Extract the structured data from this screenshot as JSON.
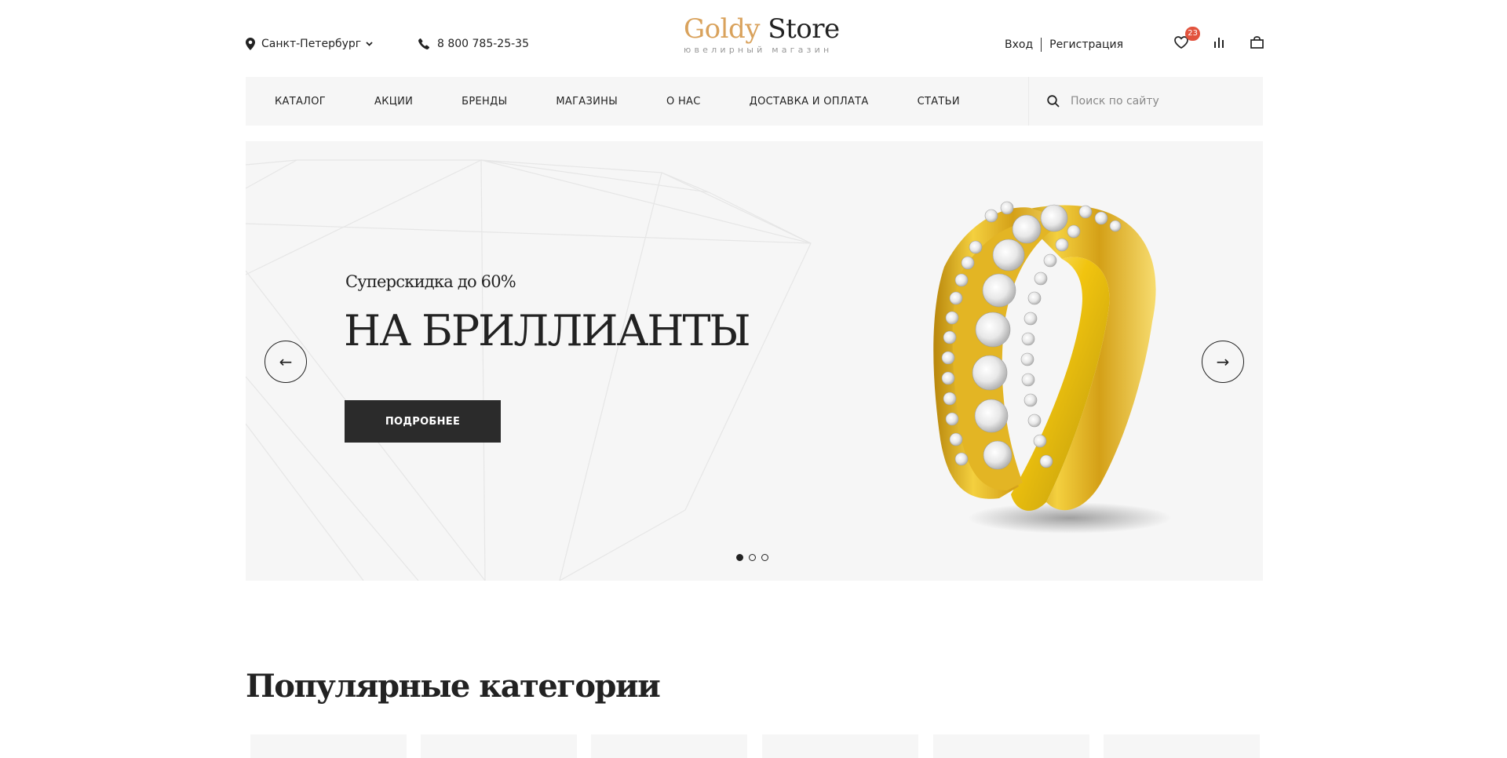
{
  "header": {
    "city": "Санкт-Петербург",
    "phone": "8 800 785-25-35",
    "logo_word1": "Goldy",
    "logo_word2": "Store",
    "logo_subtitle": "ювелирный магазин",
    "login": "Вход",
    "register": "Регистрация",
    "wishlist_count": "23",
    "icons": [
      "location-icon",
      "chevron-down-icon",
      "phone-icon",
      "heart-icon",
      "compare-icon",
      "bag-icon"
    ]
  },
  "nav": {
    "items": [
      "КАТАЛОГ",
      "АКЦИИ",
      "БРЕНДЫ",
      "МАГАЗИНЫ",
      "О НАС",
      "ДОСТАВКА И ОПЛАТА",
      "СТАТЬИ"
    ],
    "search_placeholder": "Поиск по сайту"
  },
  "hero": {
    "subtitle": "Суперскидка до 60%",
    "title": "НА БРИЛЛИАНТЫ",
    "button": "ПОДРОБНЕЕ",
    "prev_arrow": "←",
    "next_arrow": "→",
    "active_slide": 1,
    "slide_count": 3
  },
  "popular": {
    "title": "Популярные категории",
    "card_count": 6
  },
  "colors": {
    "accent_gold": "#d9a25c",
    "dark": "#2b2b2b",
    "panel": "#f6f6f6",
    "badge": "#e2533d"
  }
}
